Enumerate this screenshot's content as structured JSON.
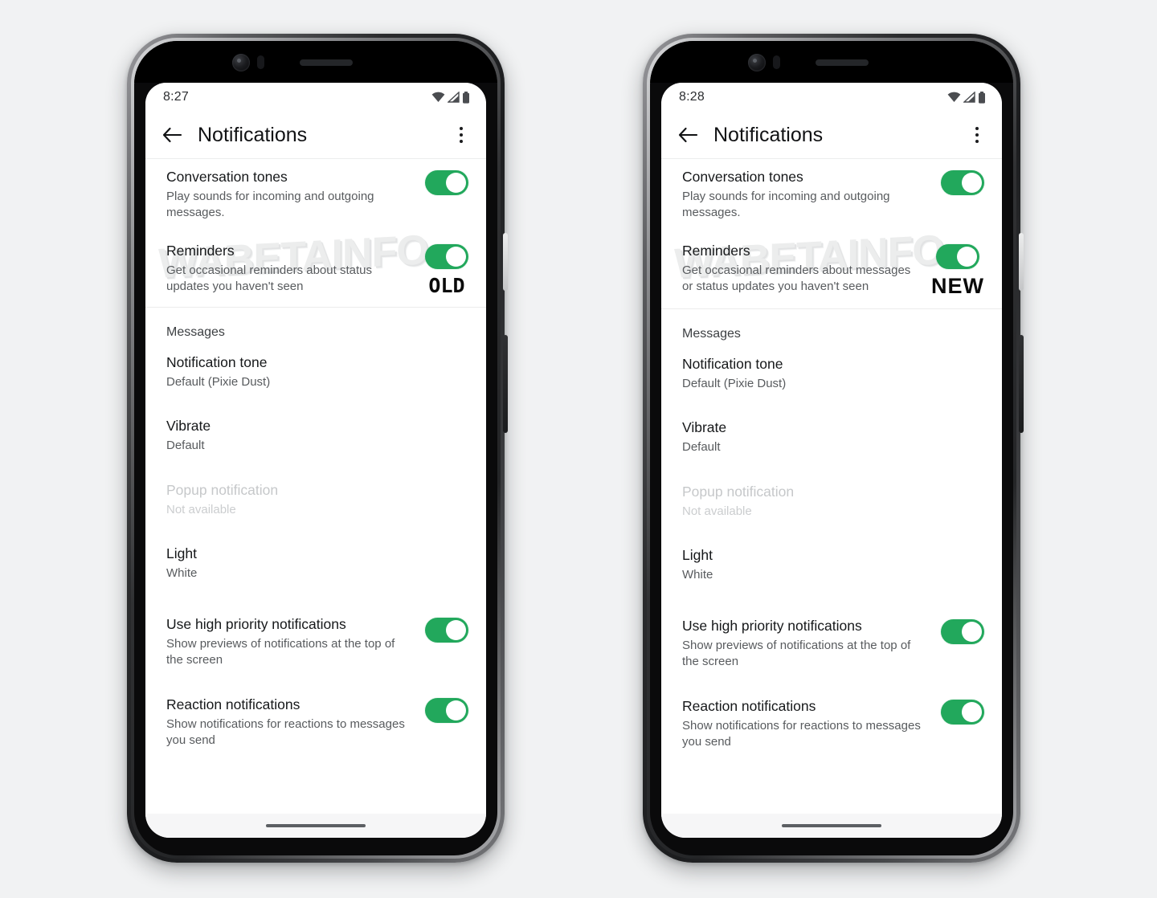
{
  "page": {
    "background_color": "#f1f2f3",
    "watermark_text": "WABETAINFO"
  },
  "phones": [
    {
      "variant_badge": "OLD",
      "status_bar": {
        "time": "8:27",
        "icons": [
          "wifi-icon",
          "cellular-signal-icon",
          "battery-icon"
        ]
      },
      "app_bar": {
        "back_icon": "arrow-left-icon",
        "title": "Notifications",
        "overflow_icon": "more-vertical-icon"
      },
      "rows_top": [
        {
          "title": "Conversation tones",
          "subtitle": "Play sounds for incoming and outgoing messages.",
          "toggle": "on",
          "badge": ""
        },
        {
          "title": "Reminders",
          "subtitle": "Get occasional reminders about status updates you haven't seen",
          "toggle": "on",
          "badge": "OLD"
        }
      ],
      "section_header": "Messages",
      "rows_messages": [
        {
          "title": "Notification tone",
          "subtitle": "Default (Pixie Dust)",
          "disabled": false
        },
        {
          "title": "Vibrate",
          "subtitle": "Default",
          "disabled": false
        },
        {
          "title": "Popup notification",
          "subtitle": "Not available",
          "disabled": true
        },
        {
          "title": "Light",
          "subtitle": "White",
          "disabled": false
        }
      ],
      "rows_bottom": [
        {
          "title": "Use high priority notifications",
          "subtitle": "Show previews of notifications at the top of the screen",
          "toggle": "on"
        },
        {
          "title": "Reaction notifications",
          "subtitle": "Show notifications for reactions to messages you send",
          "toggle": "on"
        }
      ]
    },
    {
      "variant_badge": "NEW",
      "status_bar": {
        "time": "8:28",
        "icons": [
          "wifi-icon",
          "cellular-signal-icon",
          "battery-icon"
        ]
      },
      "app_bar": {
        "back_icon": "arrow-left-icon",
        "title": "Notifications",
        "overflow_icon": "more-vertical-icon"
      },
      "rows_top": [
        {
          "title": "Conversation tones",
          "subtitle": "Play sounds for incoming and outgoing messages.",
          "toggle": "on",
          "badge": ""
        },
        {
          "title": "Reminders",
          "subtitle": "Get occasional reminders about messages or status updates you haven't seen",
          "toggle": "on",
          "badge": "NEW"
        }
      ],
      "section_header": "Messages",
      "rows_messages": [
        {
          "title": "Notification tone",
          "subtitle": "Default (Pixie Dust)",
          "disabled": false
        },
        {
          "title": "Vibrate",
          "subtitle": "Default",
          "disabled": false
        },
        {
          "title": "Popup notification",
          "subtitle": "Not available",
          "disabled": true
        },
        {
          "title": "Light",
          "subtitle": "White",
          "disabled": false
        }
      ],
      "rows_bottom": [
        {
          "title": "Use high priority notifications",
          "subtitle": "Show previews of notifications at the top of the screen",
          "toggle": "on"
        },
        {
          "title": "Reaction notifications",
          "subtitle": "Show notifications for reactions to messages you send",
          "toggle": "on"
        }
      ]
    }
  ],
  "colors": {
    "toggle_on": "#22a85c",
    "title_text": "#16181a",
    "subtitle_text": "#585b5e",
    "disabled_text": "#c6c8ca",
    "divider": "#ececec"
  }
}
